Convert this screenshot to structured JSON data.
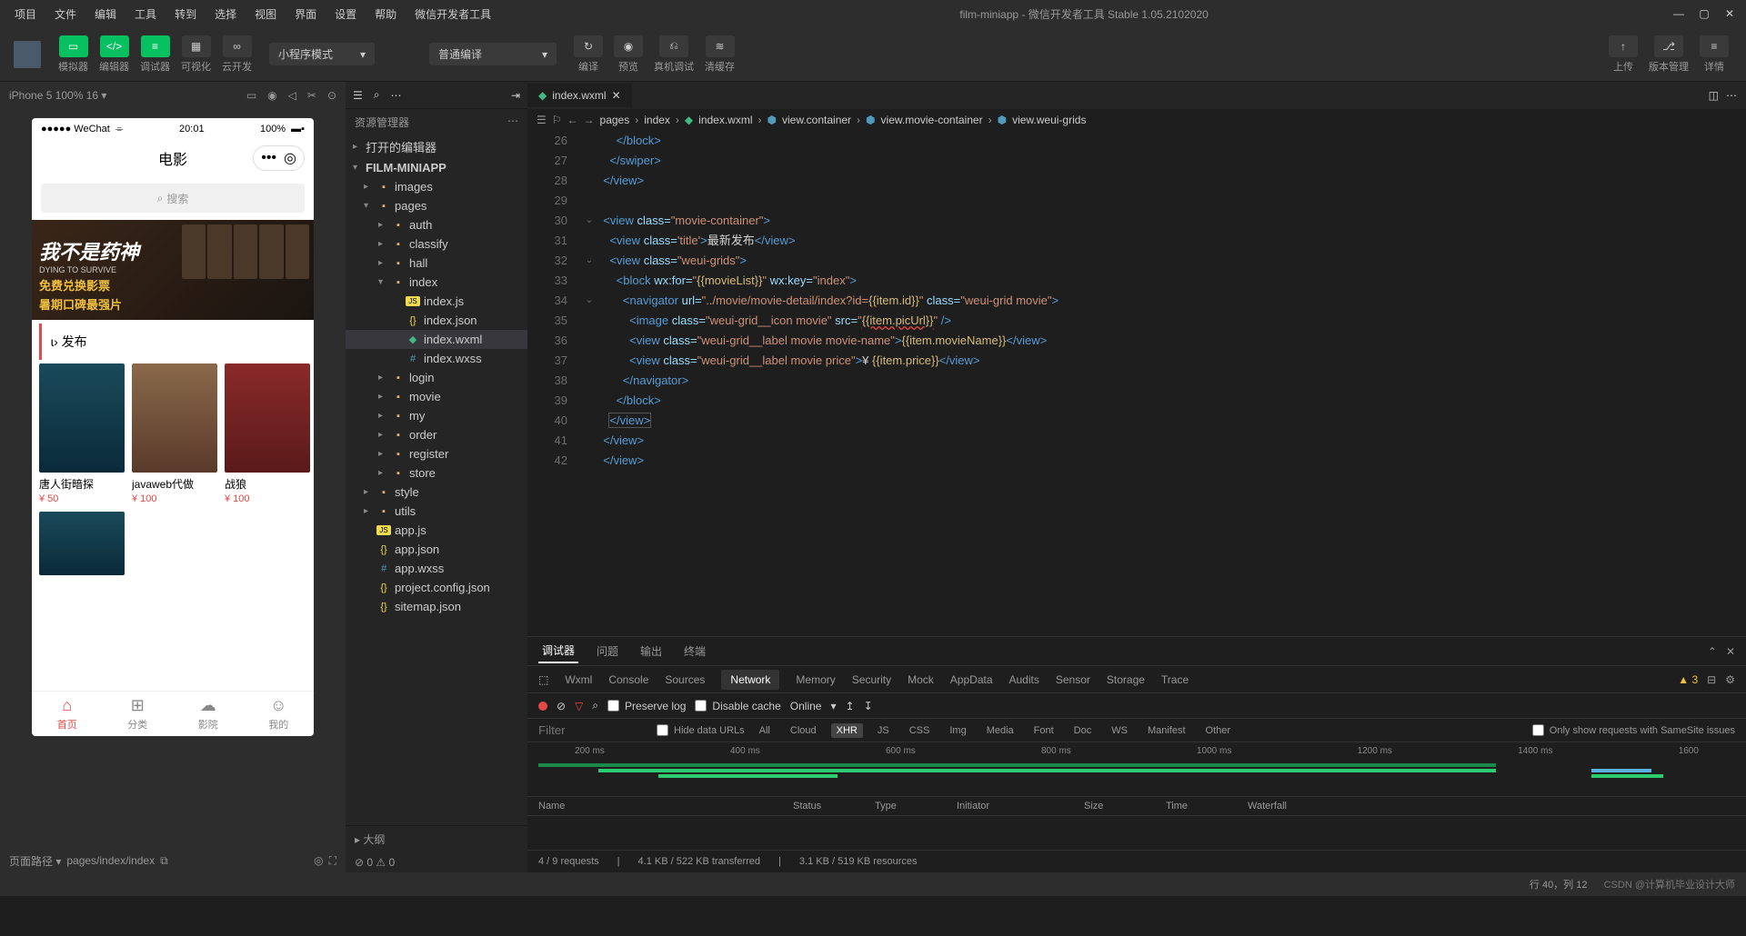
{
  "titlebar": {
    "title": "film-miniapp - 微信开发者工具 Stable 1.05.2102020",
    "menu": [
      "项目",
      "文件",
      "编辑",
      "工具",
      "转到",
      "选择",
      "视图",
      "界面",
      "设置",
      "帮助",
      "微信开发者工具"
    ]
  },
  "toolbar": {
    "buttons": [
      {
        "label": "模拟器",
        "icon": "▭"
      },
      {
        "label": "编辑器",
        "icon": "</>"
      },
      {
        "label": "调试器",
        "icon": "≡"
      },
      {
        "label": "可视化",
        "icon": "▦"
      },
      {
        "label": "云开发",
        "icon": "∞"
      }
    ],
    "mode": "小程序模式",
    "compile": "普通编译",
    "mid": [
      {
        "label": "编译",
        "icon": "↻"
      },
      {
        "label": "预览",
        "icon": "◉"
      },
      {
        "label": "真机调试",
        "icon": "⎌"
      },
      {
        "label": "清缓存",
        "icon": "≋"
      }
    ],
    "right": [
      {
        "label": "上传",
        "icon": "↑"
      },
      {
        "label": "版本管理",
        "icon": "⎇"
      },
      {
        "label": "详情",
        "icon": "≡"
      }
    ]
  },
  "simulator": {
    "device": "iPhone 5 100% 16 ▾",
    "status": {
      "carrier": "●●●●● WeChat",
      "wifi": "⌯",
      "time": "20:01",
      "battery": "100%"
    },
    "title": "电影",
    "search": "搜索",
    "section": "ɩ› 发布",
    "banner": {
      "title": "我不是药神",
      "eng": "DYING TO SURVIVE",
      "l1": "免费兑换影票",
      "l2": "暑期口碑最强片"
    },
    "movies": [
      {
        "name": "唐人街暗探",
        "price": "¥ 50"
      },
      {
        "name": "javaweb代做",
        "price": "¥ 100"
      },
      {
        "name": "战狼",
        "price": "¥ 100"
      }
    ],
    "tabs": [
      {
        "label": "首页",
        "icon": "⌂"
      },
      {
        "label": "分类",
        "icon": "⊞"
      },
      {
        "label": "影院",
        "icon": "☁"
      },
      {
        "label": "我的",
        "icon": "☺"
      }
    ]
  },
  "footer": {
    "label": "页面路径 ▾",
    "path": "pages/index/index"
  },
  "explorer": {
    "title": "资源管理器",
    "section1": "打开的编辑器",
    "project": "FILM-MINIAPP",
    "outline": "▸ 大纲",
    "items": [
      "images",
      "pages",
      "auth",
      "classify",
      "hall",
      "index",
      "index.js",
      "index.json",
      "index.wxml",
      "index.wxss",
      "login",
      "movie",
      "my",
      "order",
      "register",
      "store",
      "style",
      "utils",
      "app.js",
      "app.json",
      "app.wxss",
      "project.config.json",
      "sitemap.json"
    ]
  },
  "editor": {
    "tab": "index.wxml",
    "breadcrumb": [
      "pages",
      "index",
      "index.wxml",
      "view.container",
      "view.movie-container",
      "view.weui-grids"
    ],
    "lines": [
      26,
      27,
      28,
      29,
      30,
      31,
      32,
      33,
      34,
      35,
      36,
      37,
      38,
      39,
      40,
      41,
      42
    ]
  },
  "code": {
    "l26": "</block>",
    "l27": "</swiper>",
    "l28": "</view>",
    "l30a": "<view",
    "l30b": "class=",
    "l30c": "\"movie-container\"",
    "l30d": ">",
    "l31a": "<view",
    "l31c": "'title'",
    "l31t": "最新发布",
    "l31e": "</view>",
    "l32c": "\"weui-grids\"",
    "l33a": "<block",
    "l33b": "wx:for=",
    "l33c": "\"",
    "l33d": "{{movieList}}",
    "l33e": "wx:key=",
    "l33f": "\"index\"",
    "l34a": "<navigator",
    "l34b": "url=",
    "l34c": "\"../movie/movie-detail/index?id=",
    "l34d": "{{item.id}}",
    "l34e": "\"weui-grid movie\"",
    "l35a": "<image",
    "l35c": "\"weui-grid__icon movie\"",
    "l35d": "src=",
    "l35e": "{{item.picUrl}}",
    "l35f": " />",
    "l36c": "\"weui-grid__label movie movie-name\"",
    "l36d": "{{item.movieName}}",
    "l37c": "\"weui-grid__label movie price\"",
    "l37d": "¥ ",
    "l37e": "{{item.price}}",
    "l38": "</navigator>",
    "l39": "</block>",
    "l40": "</view>",
    "l41": "</view>",
    "l42": "</view>"
  },
  "console": {
    "tabs": [
      "调试器",
      "问题",
      "输出",
      "终端"
    ],
    "subtabs": [
      "Wxml",
      "Console",
      "Sources",
      "Network",
      "Memory",
      "Security",
      "Mock",
      "AppData",
      "Audits",
      "Sensor",
      "Storage",
      "Trace"
    ],
    "warn": "3",
    "preserve": "Preserve log",
    "disable": "Disable cache",
    "online": "Online",
    "filter": "Filter",
    "hide": "Hide data URLs",
    "chips": [
      "All",
      "Cloud",
      "XHR",
      "JS",
      "CSS",
      "Img",
      "Media",
      "Font",
      "Doc",
      "WS",
      "Manifest",
      "Other"
    ],
    "samesite": "Only show requests with SameSite issues",
    "ticks": [
      "200 ms",
      "400 ms",
      "600 ms",
      "800 ms",
      "1000 ms",
      "1200 ms",
      "1400 ms",
      "1600"
    ],
    "cols": [
      "Name",
      "Status",
      "Type",
      "Initiator",
      "Size",
      "Time",
      "Waterfall"
    ],
    "status": [
      "4 / 9 requests",
      "4.1 KB / 522 KB transferred",
      "3.1 KB / 519 KB resources"
    ]
  },
  "statusbar": {
    "errors": "⊘ 0 ⚠ 0",
    "pos": "行 40，列 12",
    "watermark": "CSDN @计算机毕业设计大师"
  }
}
